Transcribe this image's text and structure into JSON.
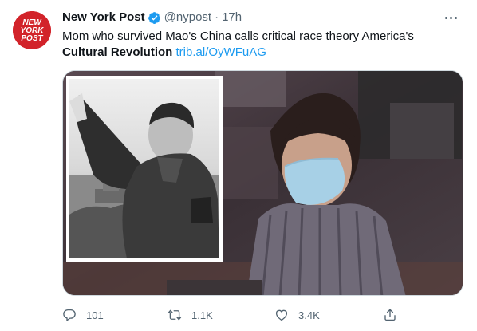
{
  "author": {
    "name": "New York Post",
    "handle": "@nypost",
    "separator": "·",
    "time": "17h",
    "avatar_logo_text": [
      "NEW",
      "YORK",
      "POST"
    ],
    "verified": true
  },
  "tweet": {
    "text_plain": "Mom who survived Mao's China calls critical race theory America's ",
    "text_bold": "Cultural Revolution",
    "link": "trib.al/OyWFuAG"
  },
  "actions": {
    "reply_count": "101",
    "retweet_count": "1.1K",
    "like_count": "3.4K"
  },
  "colors": {
    "accent": "#1d9bf0",
    "verified": "#1d9bf0",
    "secondary_text": "#536471",
    "brand_red": "#d2232a"
  },
  "icons": [
    "verified-badge-icon",
    "more-options-icon",
    "reply-icon",
    "retweet-icon",
    "like-icon",
    "share-icon"
  ]
}
